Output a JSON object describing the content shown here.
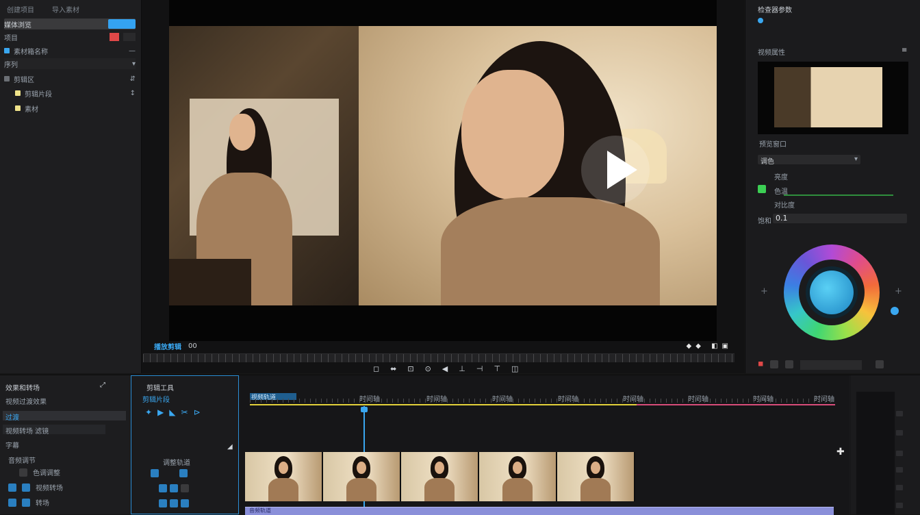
{
  "left_panel": {
    "tabs": [
      "创建项目",
      "导入素材"
    ],
    "rows": [
      {
        "label": "媒体浏览",
        "selected": true
      },
      {
        "label": "项目",
        "badge": "●"
      },
      {
        "label": "素材箱名称",
        "trail": "—"
      },
      {
        "label": "序列",
        "trail": "▾"
      },
      {
        "label": "剪辑区",
        "trail": "⇵"
      },
      {
        "label": "剪辑片段",
        "trail": "↕"
      },
      {
        "label": "素材"
      }
    ]
  },
  "viewer": {
    "timecode_label": "播放剪辑",
    "timecode_value": "00",
    "toolbar": [
      "◻",
      "⬌",
      "⊡",
      "⊙",
      "◀",
      "⊥",
      "⊣",
      "⊤",
      "◫"
    ]
  },
  "right_panel": {
    "title": "检查器参数",
    "section": "视频属性",
    "preview_caption": "预览窗口",
    "dropdown": "调色",
    "rows": [
      {
        "label": "亮度"
      },
      {
        "label": "色温"
      },
      {
        "label": "对比度"
      },
      {
        "label": "饱和"
      }
    ],
    "value_readout": "0.1",
    "footer_buttons": [
      "◼",
      "▣",
      "▣▣",
      "▣"
    ]
  },
  "effects_panel": {
    "title": "效果和转场",
    "subtitle": "视频过渡效果",
    "selected": "过渡",
    "field": "视频转场 滤镜",
    "label_row": "字幕",
    "group": "音频调节",
    "items": [
      "色调调整",
      "视频转场",
      "转场"
    ]
  },
  "tools_panel": {
    "title": "剪辑工具",
    "sub": "剪辑片段",
    "group": "调整轨道"
  },
  "timeline": {
    "track_name": "视频轨道",
    "markers": [
      "时间轴",
      "时间轴",
      "时间轴",
      "时间轴",
      "时间轴",
      "时间轴",
      "时间轴",
      "时间轴"
    ],
    "clip_count": 5,
    "audio_label": "音频轨道",
    "accent_yellow": "#e3d13a",
    "accent_pink": "#d94d7a",
    "playhead_color": "#3aa7f0"
  },
  "colors": {
    "accent": "#3aa7f0",
    "record": "#e04848",
    "green": "#3ccf54"
  }
}
